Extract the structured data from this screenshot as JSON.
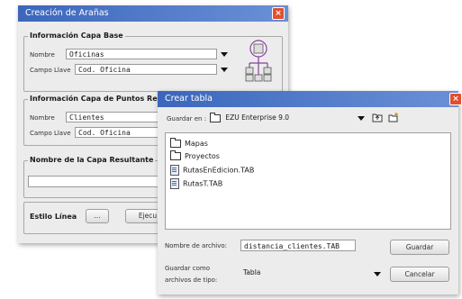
{
  "spider_dialog": {
    "title": "Creación de Arañas",
    "base_layer": {
      "heading": "Información Capa Base",
      "name_label": "Nombre",
      "name_value": "Oficinas",
      "key_label": "Campo Llave",
      "key_value": "Cod. Oficina"
    },
    "points_layer": {
      "heading": "Información Capa de Puntos Re",
      "name_label": "Nombre",
      "name_value": "Clientes",
      "key_label": "Campo Llave",
      "key_value": "Cod. Oficina"
    },
    "result_layer": {
      "heading": "Nombre de la Capa Resultante"
    },
    "line_style_label": "Estilo Línea",
    "line_style_button": "...",
    "execute_button": "Ejecu",
    "icon": "network-diagram-icon"
  },
  "save_dialog": {
    "title": "Crear tabla",
    "save_in_label": "Guardar en :",
    "save_in_value": "EZU Enterprise 9.0",
    "files": [
      {
        "name": "Mapas",
        "icon": "folder-icon"
      },
      {
        "name": "Proyectos",
        "icon": "folder-icon"
      },
      {
        "name": "RutasEnEdicion.TAB",
        "icon": "table-file-icon"
      },
      {
        "name": "RutasT.TAB",
        "icon": "table-file-icon"
      }
    ],
    "filename_label": "Nombre de archivo:",
    "filename_value": "distancia_clientes.TAB",
    "filetype_label_1": "Guardar como",
    "filetype_label_2": "archivos de tipo:",
    "filetype_value": "Tabla",
    "save_button": "Guardar",
    "cancel_button": "Cancelar"
  },
  "colors": {
    "titlebar": "#3b66bc",
    "window_bg": "#ececec",
    "close_button": "#e05030",
    "icon_accent": "#8a3f9a"
  }
}
